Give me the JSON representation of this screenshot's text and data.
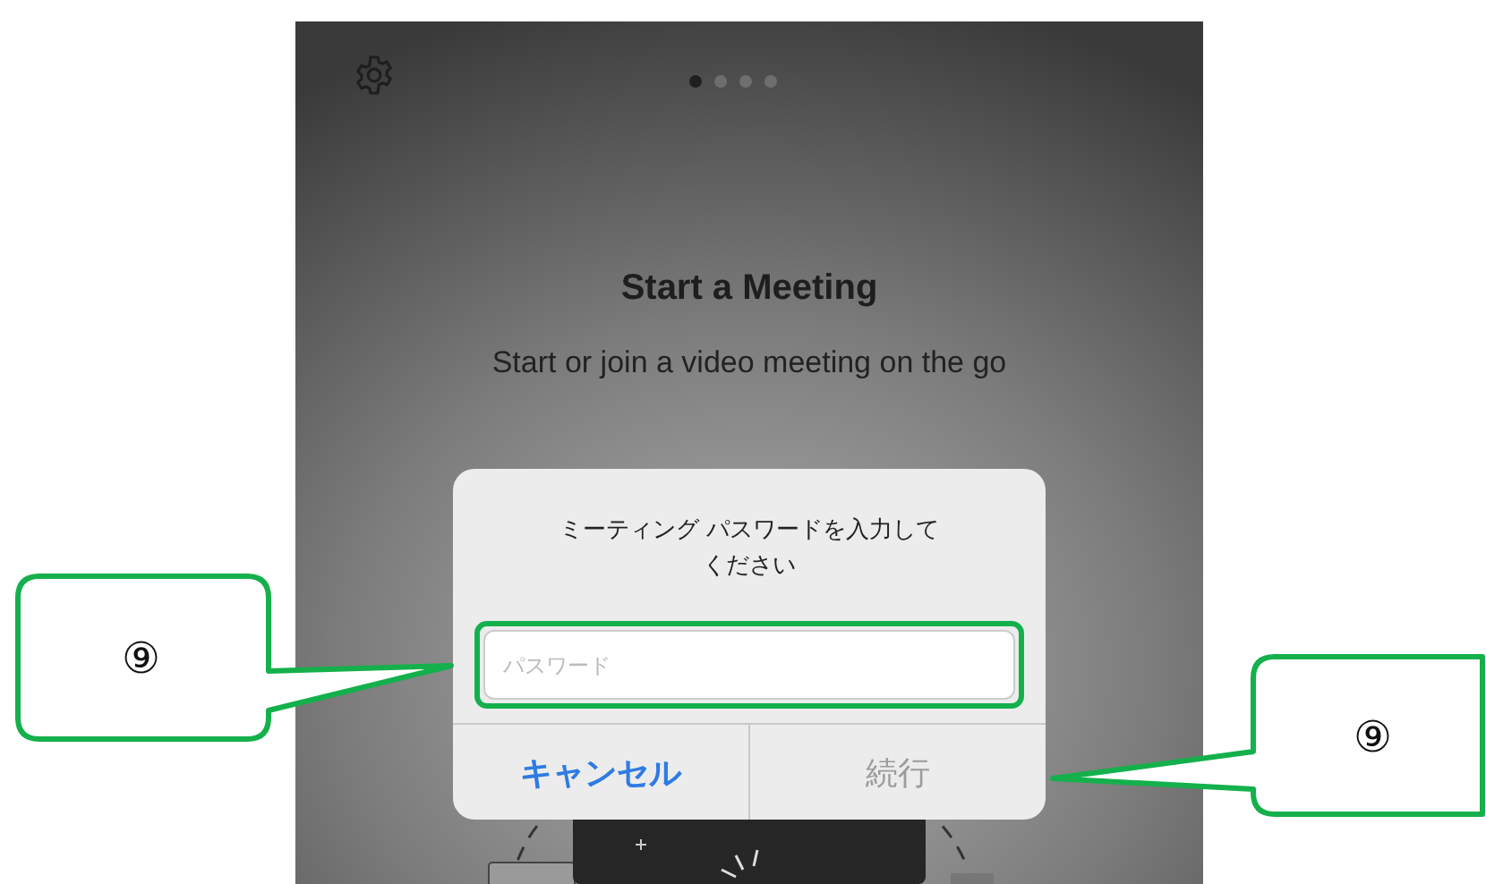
{
  "screen": {
    "page_dots": [
      {
        "selected": true
      },
      {
        "selected": false
      },
      {
        "selected": false
      },
      {
        "selected": false
      }
    ],
    "title": "Start a Meeting",
    "subtitle": "Start or join a video meeting on the go"
  },
  "dialog": {
    "message": "ミーティング パスワードを入力してください",
    "password_field": {
      "placeholder": "パスワード"
    },
    "buttons": [
      {
        "label": "キャンセル",
        "kind": "cancel",
        "disabled": false
      },
      {
        "label": "続行",
        "kind": "confirm",
        "disabled": true
      }
    ]
  },
  "callouts": [
    {
      "number": "⑨"
    },
    {
      "number": "⑨"
    }
  ]
}
